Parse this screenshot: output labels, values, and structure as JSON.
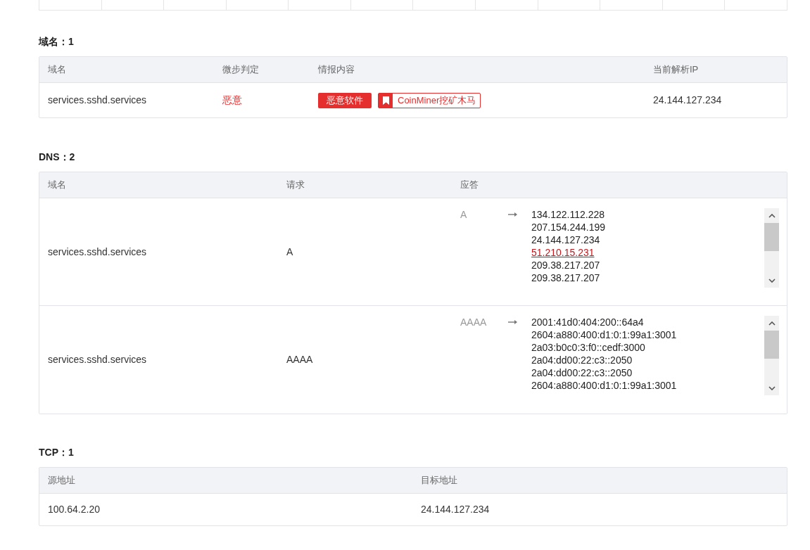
{
  "domains": {
    "heading": "域名：1",
    "columns": [
      "域名",
      "微步判定",
      "情报内容",
      "当前解析IP"
    ],
    "rows": [
      {
        "domain": "services.sshd.services",
        "verdict": "恶意",
        "malicious": true,
        "tags": [
          {
            "kind": "solid",
            "label": "恶意软件"
          },
          {
            "kind": "outlined",
            "label": "CoinMiner挖矿木马"
          }
        ],
        "ip": "24.144.127.234"
      }
    ]
  },
  "dns": {
    "heading": "DNS：2",
    "columns": [
      "域名",
      "请求",
      "应答"
    ],
    "rows": [
      {
        "domain": "services.sshd.services",
        "request": "A",
        "answer_type": "A",
        "answers": [
          {
            "text": "134.122.112.228",
            "flagged": false
          },
          {
            "text": "207.154.244.199",
            "flagged": false
          },
          {
            "text": "24.144.127.234",
            "flagged": false
          },
          {
            "text": "51.210.15.231",
            "flagged": true
          },
          {
            "text": "209.38.217.207",
            "flagged": false
          },
          {
            "text": "209.38.217.207",
            "flagged": false
          }
        ]
      },
      {
        "domain": "services.sshd.services",
        "request": "AAAA",
        "answer_type": "AAAA",
        "answers": [
          {
            "text": "2001:41d0:404:200::64a4",
            "flagged": false
          },
          {
            "text": "2604:a880:400:d1:0:1:99a1:3001",
            "flagged": false
          },
          {
            "text": "2a03:b0c0:3:f0::cedf:3000",
            "flagged": false
          },
          {
            "text": "2a04:dd00:22:c3::2050",
            "flagged": false
          },
          {
            "text": "2a04:dd00:22:c3::2050",
            "flagged": false
          },
          {
            "text": "2604:a880:400:d1:0:1:99a1:3001",
            "flagged": false
          }
        ]
      }
    ]
  },
  "tcp": {
    "heading": "TCP：1",
    "columns": [
      "源地址",
      "目标地址"
    ],
    "rows": [
      {
        "source": "100.64.2.20",
        "target": "24.144.127.234"
      }
    ]
  }
}
